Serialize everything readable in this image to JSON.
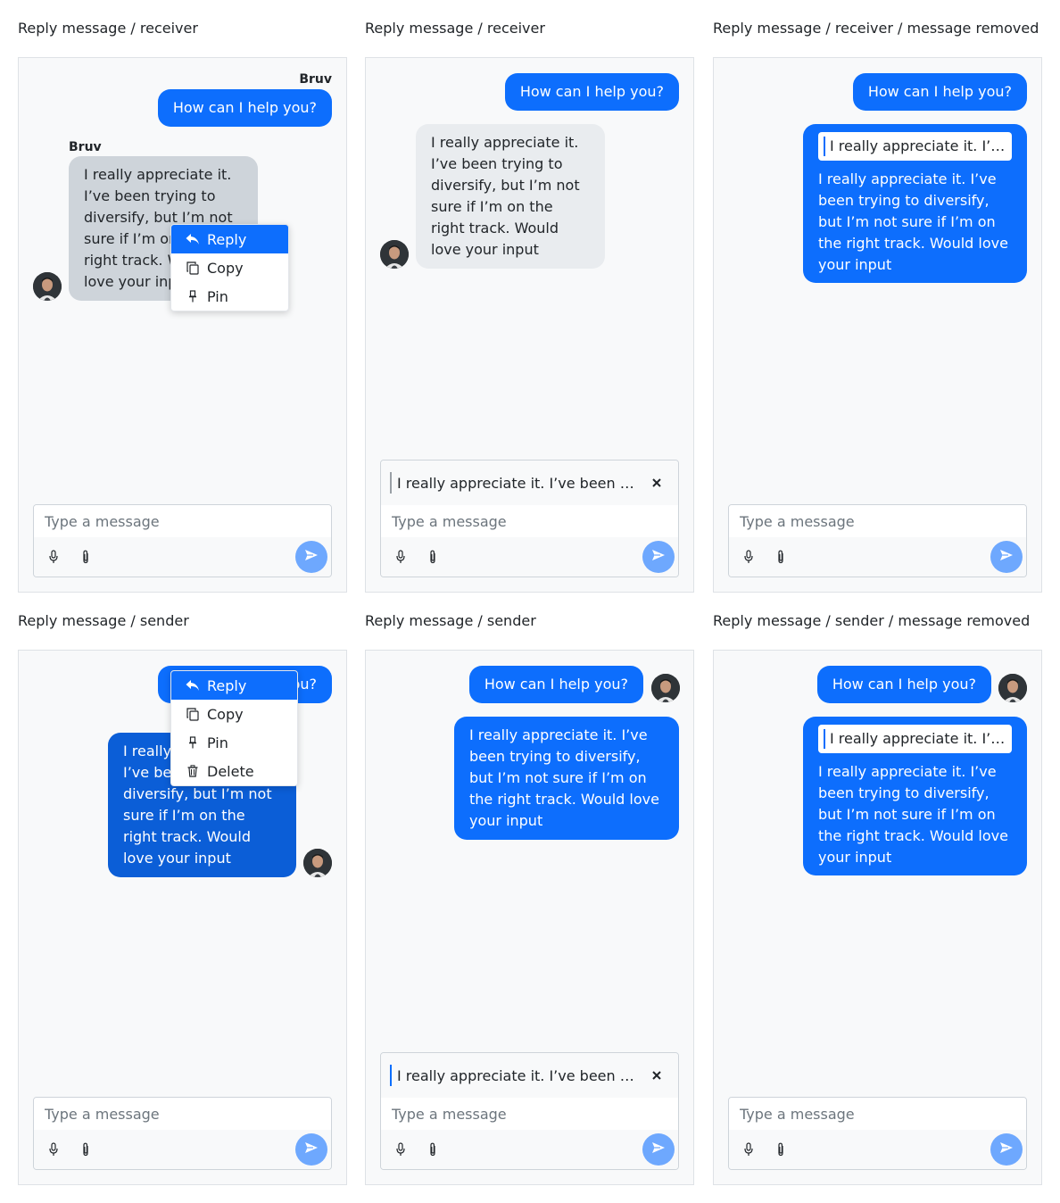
{
  "captions": {
    "c1": "Reply message / receiver",
    "c2": "Reply message / receiver",
    "c3": "Reply message / receiver / message removed",
    "c4": "Reply message / sender",
    "c5": "Reply message / sender",
    "c6": "Reply message / sender / message removed"
  },
  "messages": {
    "question": "How can I help you?",
    "answer": "I really appreciate it. I’ve been trying to diversify, but I’m not sure if I’m on the right track. Would love your input",
    "answer_visible_under_menu": "I really appreciate it. I’ve been trying to diversify, but I’m not sure if I’m o",
    "quote_short": "I really appreciate it. I’…",
    "reply_preview": "I really appreciate it. I’ve been …"
  },
  "sender_name": "Bruv",
  "menu": {
    "reply": "Reply",
    "copy": "Copy",
    "pin": "Pin",
    "delete": "Delete"
  },
  "composer": {
    "placeholder": "Type a message"
  },
  "icons": {
    "mic": "microphone-icon",
    "attach": "paperclip-icon",
    "send": "send-icon",
    "close": "close-icon",
    "reply": "reply-icon",
    "copy": "copy-icon",
    "pin": "pin-icon",
    "delete": "trash-icon"
  },
  "colors": {
    "primary": "#0d6efd",
    "primary_pressed": "#0b5ed7",
    "send_disabled": "#6ea8fe",
    "receiver_bubble": "#e9ecef",
    "receiver_bubble_pressed": "#ced4da",
    "panel_bg": "#f8f9fa"
  }
}
